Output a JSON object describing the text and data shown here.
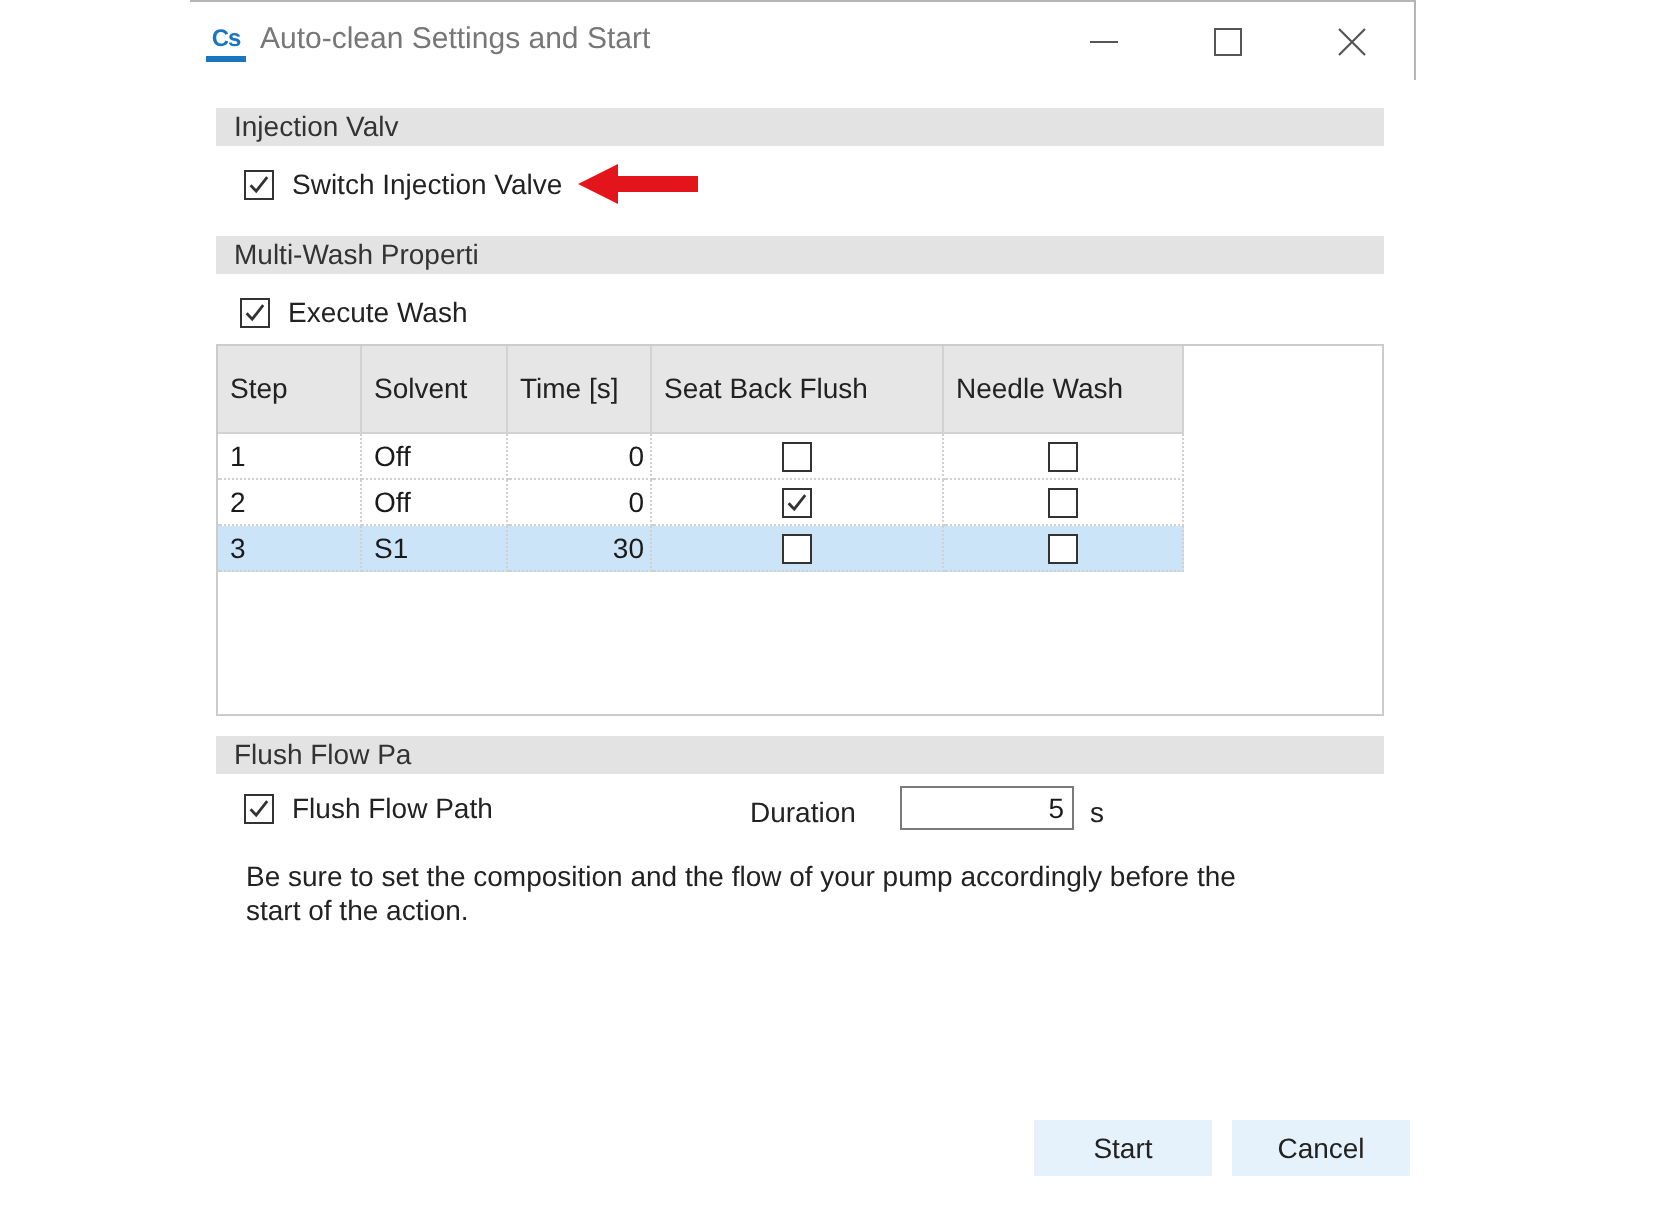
{
  "window": {
    "logo_text": "Cs",
    "title": "Auto-clean Settings and Start"
  },
  "injection_valve": {
    "header": "Injection Valv",
    "checkbox": {
      "label": "Switch Injection Valve",
      "checked": true
    }
  },
  "multi_wash": {
    "header": "Multi-Wash Properti",
    "checkbox": {
      "label": "Execute Wash",
      "checked": true
    },
    "table": {
      "columns": [
        {
          "label": "Step"
        },
        {
          "label": "Solvent"
        },
        {
          "label": "Time [s]"
        },
        {
          "label": "Seat Back Flush"
        },
        {
          "label": "Needle Wash"
        }
      ],
      "rows": [
        {
          "selected": false,
          "cells": [
            {
              "kind": "text",
              "value": "1"
            },
            {
              "kind": "text",
              "value": "Off"
            },
            {
              "kind": "number",
              "value": "0"
            },
            {
              "kind": "check",
              "checked": false
            },
            {
              "kind": "check",
              "checked": false
            }
          ]
        },
        {
          "selected": false,
          "cells": [
            {
              "kind": "text",
              "value": "2"
            },
            {
              "kind": "text",
              "value": "Off"
            },
            {
              "kind": "number",
              "value": "0"
            },
            {
              "kind": "check",
              "checked": true
            },
            {
              "kind": "check",
              "checked": false
            }
          ]
        },
        {
          "selected": true,
          "cells": [
            {
              "kind": "text",
              "value": "3"
            },
            {
              "kind": "text",
              "value": "S1"
            },
            {
              "kind": "number",
              "value": "30"
            },
            {
              "kind": "check",
              "checked": false
            },
            {
              "kind": "check",
              "checked": false
            }
          ]
        }
      ]
    }
  },
  "flush_flow": {
    "header": "Flush Flow Pa",
    "checkbox": {
      "label": "Flush Flow Path",
      "checked": true
    },
    "duration": {
      "label": "Duration",
      "value": "5",
      "unit": "s"
    },
    "note": "Be sure to set the composition and the flow of your pump accordingly before the start of the action."
  },
  "buttons": [
    {
      "label": "Start"
    },
    {
      "label": "Cancel"
    }
  ]
}
